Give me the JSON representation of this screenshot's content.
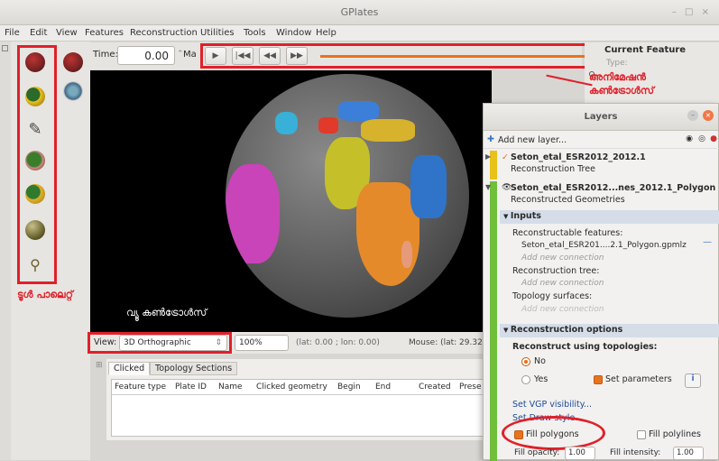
{
  "window": {
    "title": "GPlates",
    "controls": "– □ ×"
  },
  "menu": {
    "file": "File",
    "edit": "Edit",
    "view": "View",
    "features": "Features",
    "reconstruction": "Reconstruction",
    "utilities": "Utilities",
    "tools": "Tools",
    "window": "Window",
    "help": "Help"
  },
  "time": {
    "label": "Time:",
    "value": "0.00",
    "unit": "Ma"
  },
  "animation_buttons": [
    "▶",
    "|◀◀",
    "◀◀",
    "▶▶"
  ],
  "current_feature": {
    "title": "Current Feature",
    "type_label": "Type:"
  },
  "annotations": {
    "animation_controls": "അനിമേഷൻ\nകൺട്രോൾസ്",
    "tool_palette": "ടൂൾ പാലെറ്റ്",
    "view_controls": "വ്യൂ കൺട്രോൾസ്"
  },
  "status": {
    "view_label": "View:",
    "projection": "3D Orthographic",
    "zoom": "100%",
    "coords": "(lat: 0.00 ; lon: 0.00)",
    "mouse": "Mouse: (lat: 29.32"
  },
  "lower_panel": {
    "tabs": [
      "Clicked",
      "Topology Sections"
    ],
    "columns": [
      "Feature type",
      "Plate ID",
      "Name",
      "Clicked geometry",
      "Begin",
      "End",
      "Created",
      "Prese"
    ]
  },
  "layers": {
    "title": "Layers",
    "add_new_layer": "Add new layer...",
    "layer1_name": "Seton_etal_ESR2012_2012.1",
    "layer1_type": "Reconstruction Tree",
    "layer2_name": "Seton_etal_ESR2012...nes_2012.1_Polygon",
    "layer2_type": "Reconstructed Geometries",
    "inputs_header": "Inputs",
    "reconstructable_features": "Reconstructable features:",
    "input_file": "Seton_etal_ESR201....2.1_Polygon.gpmlz",
    "add_new_connection": "Add new connection",
    "reconstruction_tree": "Reconstruction tree:",
    "topology_surfaces": "Topology surfaces:",
    "recon_options_header": "Reconstruction options",
    "reconstruct_using_topologies": "Reconstruct using topologies:",
    "no": "No",
    "yes": "Yes",
    "set_parameters": "Set parameters",
    "set_vgp_visibility": "Set VGP visibility...",
    "set_draw_style": "Set Draw style...",
    "fill_polygons": "Fill polygons",
    "fill_polylines": "Fill polylines",
    "fill_opacity": "Fill opacity:",
    "fill_opacity_value": "1.00",
    "fill_intensity": "Fill intensity:",
    "fill_intensity_value": "1.00"
  },
  "colors": {
    "accent": "#e8731e",
    "annotation_red": "#e0202a",
    "green_bar": "#6fbf3a"
  }
}
